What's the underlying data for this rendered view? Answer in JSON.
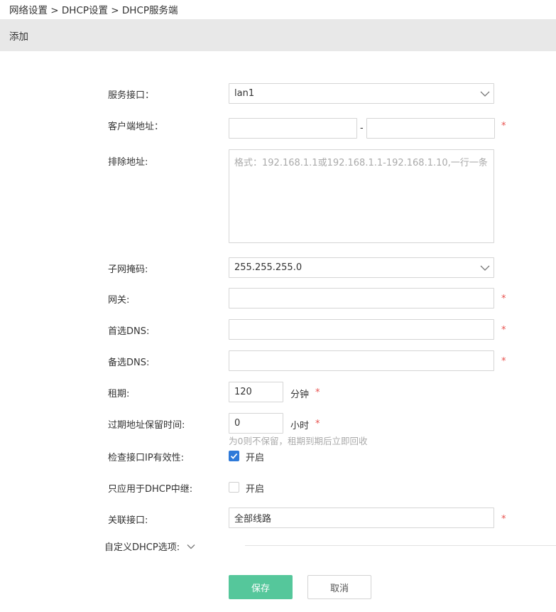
{
  "breadcrumb": "网络设置 > DHCP设置 > DHCP服务端",
  "panel_title": "添加",
  "required_mark": "*",
  "form": {
    "service_interface": {
      "label": "服务接口：",
      "value": "lan1"
    },
    "client_address": {
      "label": "客户端地址：",
      "start_value": "",
      "end_value": "",
      "separator": "-"
    },
    "exclude_address": {
      "label": "排除地址:",
      "placeholder": "格式：192.168.1.1或192.168.1.1-192.168.1.10,一行一条"
    },
    "subnet_mask": {
      "label": "子网掩码:",
      "value": "255.255.255.0"
    },
    "gateway": {
      "label": "网关:",
      "value": ""
    },
    "primary_dns": {
      "label": "首选DNS:",
      "value": ""
    },
    "secondary_dns": {
      "label": "备选DNS:",
      "value": ""
    },
    "lease": {
      "label": "租期:",
      "value": "120",
      "unit": "分钟"
    },
    "expired_reserve": {
      "label": "过期地址保留时间:",
      "value": "0",
      "unit": "小时",
      "hint": "为0则不保留，租期到期后立即回收"
    },
    "check_interface_ip": {
      "label": "检查接口IP有效性:",
      "checked": true,
      "text": "开启"
    },
    "relay_only": {
      "label": "只应用于DHCP中继:",
      "checked": false,
      "text": "开启"
    },
    "associated_interface": {
      "label": "关联接口:",
      "value": "全部线路"
    },
    "custom_options": {
      "label": "自定义DHCP选项:"
    }
  },
  "buttons": {
    "save": "保存",
    "cancel": "取消"
  },
  "colors": {
    "primary": "#55c79b",
    "checkbox": "#2f7ad9",
    "required": "#e8524f",
    "header_bg": "#e8e8e8"
  }
}
